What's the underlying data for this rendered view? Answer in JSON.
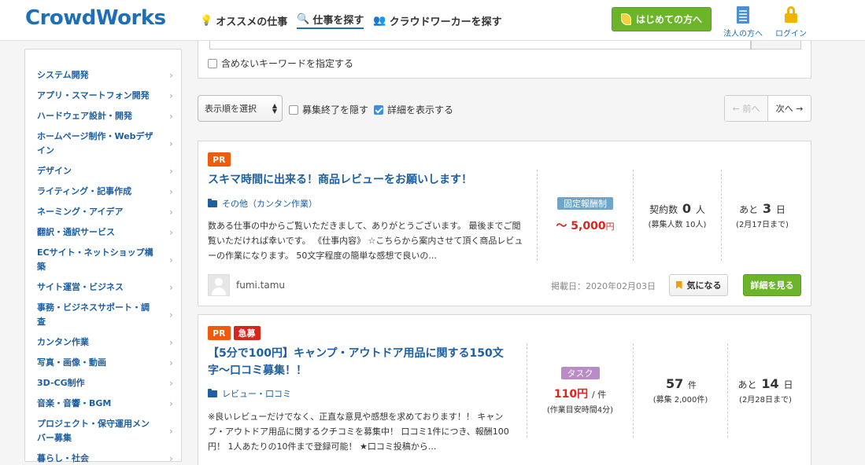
{
  "header": {
    "logo": "CrowdWorks",
    "nav": [
      {
        "label": "オススメの仕事"
      },
      {
        "label": "仕事を探す"
      },
      {
        "label": "クラウドワーカーを探す"
      }
    ],
    "beginner_button": "はじめての方へ",
    "corporate_link": "法人の方へ",
    "login_link": "ログイン"
  },
  "sidebar": {
    "categories": [
      "システム開発",
      "アプリ・スマートフォン開発",
      "ハードウェア設計・開発",
      "ホームページ制作・Webデザイン",
      "デザイン",
      "ライティング・記事作成",
      "ネーミング・アイデア",
      "翻訳・通訳サービス",
      "ECサイト・ネットショップ構築",
      "サイト運営・ビジネス",
      "事務・ビジネスサポート・調査",
      "カンタン作業",
      "写真・画像・動画",
      "3D-CG制作",
      "音楽・音響・BGM",
      "プロジェクト・保守運用メンバー募集",
      "暮らし・社会"
    ]
  },
  "search": {
    "exclude_keywords_label": "含めないキーワードを指定する"
  },
  "toolbar": {
    "sort_label": "表示順を選択",
    "hide_closed_label": "募集終了を隠す",
    "show_details_label": "詳細を表示する",
    "prev_label": "← 前へ",
    "next_label": "次へ →"
  },
  "jobs": [
    {
      "badges": [
        "PR"
      ],
      "title": "スキマ時間に出来る！商品レビューをお願いします！",
      "category": "その他（カンタン作業）",
      "description": "数ある仕事の中からご覧いただきまして、ありがとうございます。 最後までご閲覧いただければ幸いです。 《仕事内容》 ☆こちらから案内させて頂く商品レビューの作業になります。 50文字程度の簡単な感想で良いの...",
      "pay_type": "固定報酬制",
      "price": "～ 5,000",
      "price_unit": "円",
      "contracts_label": "契約数",
      "contracts_value": "0",
      "contracts_unit": "人",
      "recruit_note": "(募集人数 10人)",
      "remaining_prefix": "あと",
      "remaining_days": "3",
      "remaining_unit": "日",
      "deadline": "(2月17日まで)",
      "user": "fumi.tamu",
      "posted": "掲載日：2020年02月03日",
      "like_label": "気になる",
      "detail_label": "詳細を見る"
    },
    {
      "badges": [
        "PR",
        "急募"
      ],
      "title_line1": "【5分で100円】キャンプ・アウトドア用品に関する150文",
      "title_line2": "字〜口コミ募集！！",
      "category": "レビュー・口コミ",
      "description": "※良いレビューだけでなく、正直な意見や感想を求めております！！ キャンプ・アウトドア用品に関するクチコミを募集中！ 口コミ1件につき、報酬100円！ 1人あたりの10件まで登録可能！ ★口コミ投稿から...",
      "pay_type": "タスク",
      "price": "110円",
      "price_unit": "/ 件",
      "time_note": "(作業目安時間4分)",
      "count_value": "57",
      "count_unit": "件",
      "recruit_note": "(募集 2,000件)",
      "remaining_prefix": "あと",
      "remaining_days": "14",
      "remaining_unit": "日",
      "deadline": "(2月28日まで)"
    }
  ]
}
